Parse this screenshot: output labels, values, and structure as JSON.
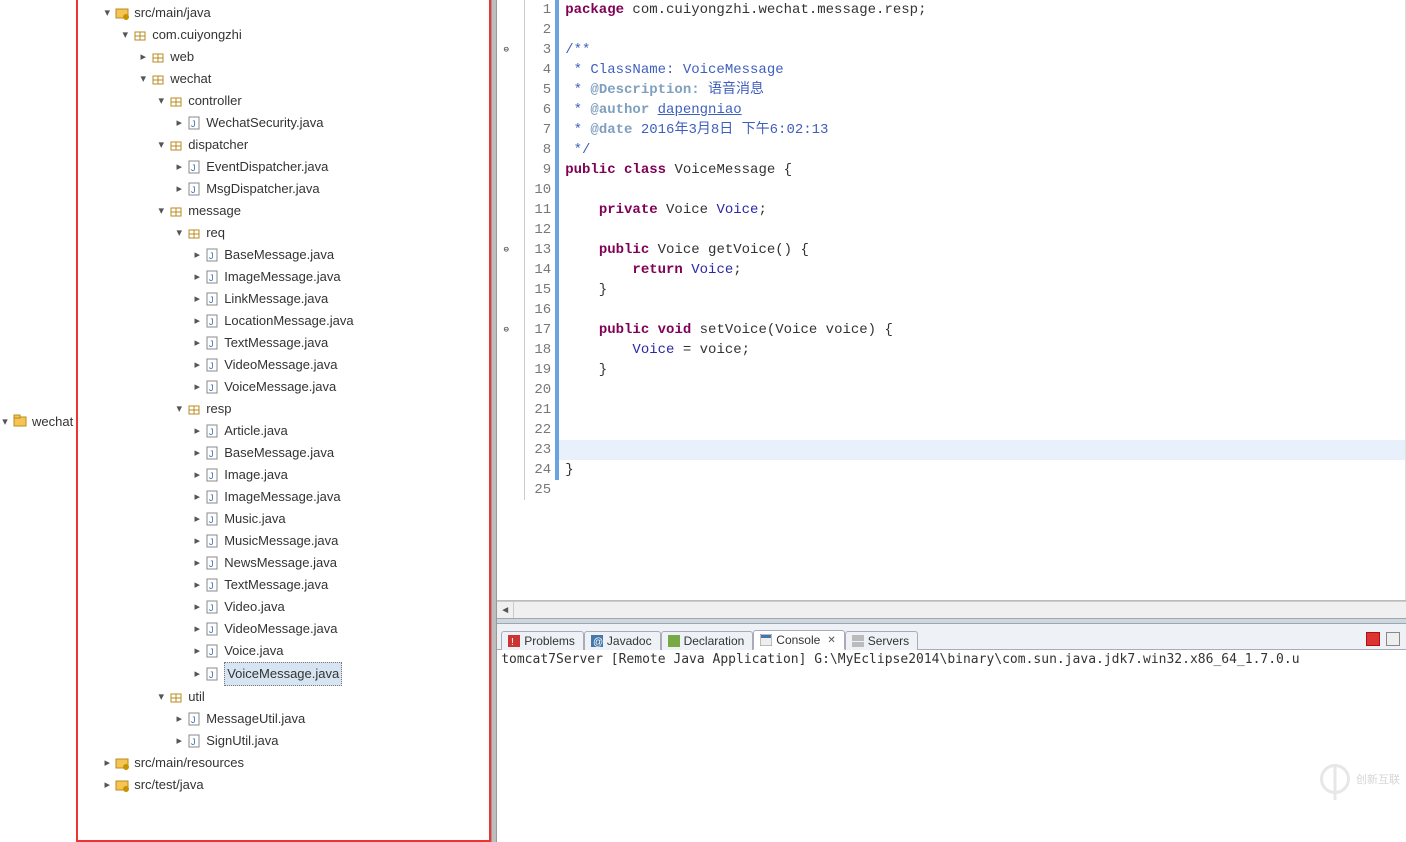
{
  "tree": {
    "project": "wechat",
    "srcRoot": "src/main/java",
    "basePackage": "com.cuiyongzhi",
    "web": "web",
    "wechat": "wechat",
    "controller": "controller",
    "controller_files": [
      "WechatSecurity.java"
    ],
    "dispatcher": "dispatcher",
    "dispatcher_files": [
      "EventDispatcher.java",
      "MsgDispatcher.java"
    ],
    "message": "message",
    "req": "req",
    "req_files": [
      "BaseMessage.java",
      "ImageMessage.java",
      "LinkMessage.java",
      "LocationMessage.java",
      "TextMessage.java",
      "VideoMessage.java",
      "VoiceMessage.java"
    ],
    "resp": "resp",
    "resp_files": [
      "Article.java",
      "BaseMessage.java",
      "Image.java",
      "ImageMessage.java",
      "Music.java",
      "MusicMessage.java",
      "NewsMessage.java",
      "TextMessage.java",
      "Video.java",
      "VideoMessage.java",
      "Voice.java",
      "VoiceMessage.java"
    ],
    "resp_selected": "VoiceMessage.java",
    "util": "util",
    "util_files": [
      "MessageUtil.java",
      "SignUtil.java"
    ],
    "srcMainResources": "src/main/resources",
    "srcTestJava": "src/test/java"
  },
  "code": {
    "lines": [
      {
        "n": 1,
        "html": "<span class='tok-kw'>package</span> com.cuiyongzhi.wechat.message.resp;"
      },
      {
        "n": 2,
        "html": ""
      },
      {
        "n": 3,
        "marker": "⊖",
        "html": "<span class='tok-doc'>/**</span>"
      },
      {
        "n": 4,
        "html": "<span class='tok-doc'> * ClassName: VoiceMessage</span>"
      },
      {
        "n": 5,
        "html": "<span class='tok-doc'> * <span class='tok-tag'>@Description:</span> <span class='tok-cn'>语音消息</span></span>"
      },
      {
        "n": 6,
        "html": "<span class='tok-doc'> * <span class='tok-tag'>@author</span> <span class='tok-link'>dapengniao</span></span>"
      },
      {
        "n": 7,
        "html": "<span class='tok-doc'> * <span class='tok-tag'>@date</span> 2016年3月8日 下午6:02:13</span>"
      },
      {
        "n": 8,
        "html": "<span class='tok-doc'> */</span>"
      },
      {
        "n": 9,
        "html": "<span class='tok-kw'>public</span> <span class='tok-kw'>class</span> VoiceMessage {"
      },
      {
        "n": 10,
        "html": ""
      },
      {
        "n": 11,
        "html": "    <span class='tok-kw'>private</span> Voice <span class='tok-field'>Voice</span>;"
      },
      {
        "n": 12,
        "html": ""
      },
      {
        "n": 13,
        "marker": "⊖",
        "html": "    <span class='tok-kw'>public</span> Voice getVoice() {"
      },
      {
        "n": 14,
        "html": "        <span class='tok-kw'>return</span> <span class='tok-field'>Voice</span>;"
      },
      {
        "n": 15,
        "html": "    }"
      },
      {
        "n": 16,
        "html": ""
      },
      {
        "n": 17,
        "marker": "⊖",
        "html": "    <span class='tok-kw'>public</span> <span class='tok-kw'>void</span> setVoice(Voice voice) {"
      },
      {
        "n": 18,
        "html": "        <span class='tok-field'>Voice</span> = voice;"
      },
      {
        "n": 19,
        "html": "    }"
      },
      {
        "n": 20,
        "html": ""
      },
      {
        "n": 21,
        "html": ""
      },
      {
        "n": 22,
        "html": ""
      },
      {
        "n": 23,
        "current": true,
        "html": ""
      },
      {
        "n": 24,
        "html": "}"
      },
      {
        "n": 25,
        "html": ""
      }
    ],
    "changeBarEnd": 24
  },
  "bottomTabs": {
    "problems": "Problems",
    "javadoc": "Javadoc",
    "declaration": "Declaration",
    "console": "Console",
    "servers": "Servers"
  },
  "consoleLine": "tomcat7Server [Remote Java Application] G:\\MyEclipse2014\\binary\\com.sun.java.jdk7.win32.x86_64_1.7.0.u",
  "watermark": "创新互联"
}
